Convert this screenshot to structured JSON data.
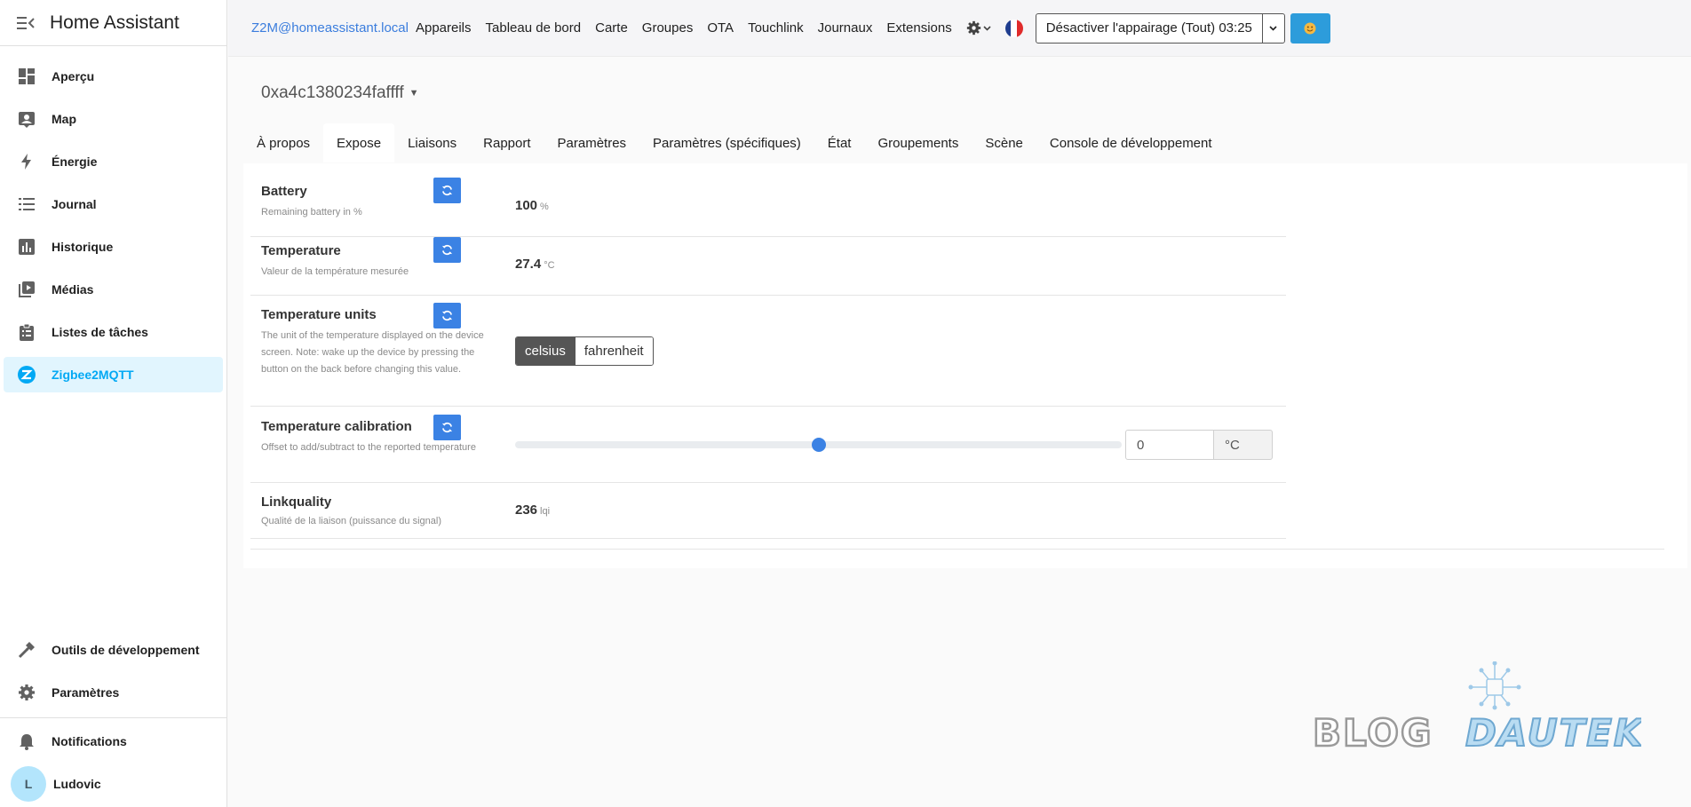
{
  "app": {
    "title": "Home Assistant"
  },
  "sidebar": {
    "items": [
      {
        "label": "Aperçu",
        "icon": "dashboard-icon"
      },
      {
        "label": "Map",
        "icon": "map-account-icon"
      },
      {
        "label": "Énergie",
        "icon": "lightning-bolt-icon"
      },
      {
        "label": "Journal",
        "icon": "format-list-icon"
      },
      {
        "label": "Historique",
        "icon": "chart-box-icon"
      },
      {
        "label": "Médias",
        "icon": "play-box-multiple-icon"
      },
      {
        "label": "Listes de tâches",
        "icon": "clipboard-list-icon"
      },
      {
        "label": "Zigbee2MQTT",
        "icon": "zigbee-icon",
        "active": true
      }
    ],
    "bottom_items": [
      {
        "label": "Outils de développement",
        "icon": "hammer-icon"
      },
      {
        "label": "Paramètres",
        "icon": "cog-icon"
      }
    ],
    "notifications": "Notifications",
    "user": {
      "name": "Ludovic",
      "initial": "L"
    }
  },
  "topbar": {
    "host": "Z2M@homeassistant.local",
    "nav": [
      "Appareils",
      "Tableau de bord",
      "Carte",
      "Groupes",
      "OTA",
      "Touchlink",
      "Journaux",
      "Extensions"
    ],
    "pairing_button": "Désactiver l'appairage (Tout) 03:25",
    "language_flag": "fr",
    "accent": "#2d9cdb"
  },
  "device": {
    "name": "0xa4c1380234faffff",
    "tabs": [
      "À propos",
      "Expose",
      "Liaisons",
      "Rapport",
      "Paramètres",
      "Paramètres (spécifiques)",
      "État",
      "Groupements",
      "Scène",
      "Console de développement"
    ],
    "active_tab": "Expose"
  },
  "exposes": {
    "battery": {
      "label": "Battery",
      "desc": "Remaining battery in %",
      "value": "100",
      "unit": "%"
    },
    "temperature": {
      "label": "Temperature",
      "desc": "Valeur de la température mesurée",
      "value": "27.4",
      "unit": "°C"
    },
    "temperature_units": {
      "label": "Temperature units",
      "desc": "The unit of the temperature displayed on the device screen. Note: wake up the device by pressing the button on the back before changing this value.",
      "options": [
        "celsius",
        "fahrenheit"
      ],
      "selected": "celsius"
    },
    "temperature_calibration": {
      "label": "Temperature calibration",
      "desc": "Offset to add/subtract to the reported temperature",
      "value": "0",
      "unit": "°C",
      "slider_fraction": 0.5
    },
    "linkquality": {
      "label": "Linkquality",
      "desc": "Qualité de la liaison (puissance du signal)",
      "value": "236",
      "unit": "lqi"
    }
  },
  "watermark": {
    "text_left": "BLOG",
    "text_right": "DAUTEK"
  }
}
